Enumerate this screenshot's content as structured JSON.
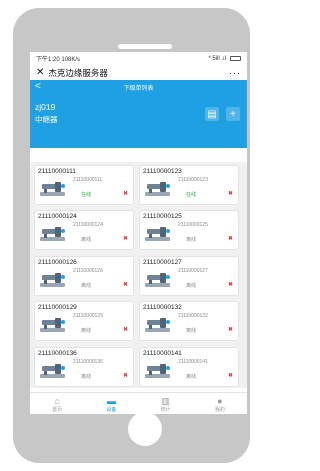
{
  "status_bar": {
    "time": "下午1:20",
    "net": "108K/s",
    "signal": "* 5ill .ıl"
  },
  "mini_header": {
    "close_icon": "close-icon",
    "title": "杰克边缘服务器",
    "more": "···"
  },
  "nav": {
    "back": "<",
    "title": "下级单列表"
  },
  "device": {
    "name": "zj019",
    "type": "中继器"
  },
  "actions": {
    "doc_icon": "▤",
    "add_icon": "+"
  },
  "colors": {
    "brand_blue": "#1fa0e2",
    "online_green": "#2aa745",
    "offline_gray": "#888888",
    "delete_red": "#e53935"
  },
  "cards": [
    {
      "title": "21110000111",
      "sub": "21110000111",
      "status": "在线",
      "status_color": "#2aa745",
      "del": "✖"
    },
    {
      "title": "21110000123",
      "sub": "21110000123",
      "status": "在线",
      "status_color": "#2aa745",
      "del": "✖"
    },
    {
      "title": "21110000124",
      "sub": "21110000124",
      "status": "离线",
      "status_color": "#888888",
      "del": "✖"
    },
    {
      "title": "21110000125",
      "sub": "21110000125",
      "status": "离线",
      "status_color": "#888888",
      "del": "✖"
    },
    {
      "title": "21110000126",
      "sub": "21110000126",
      "status": "离线",
      "status_color": "#888888",
      "del": "✖"
    },
    {
      "title": "21110000127",
      "sub": "21110000127",
      "status": "离线",
      "status_color": "#888888",
      "del": "✖"
    },
    {
      "title": "21110000129",
      "sub": "21110000129",
      "status": "离线",
      "status_color": "#888888",
      "del": "✖"
    },
    {
      "title": "21110000132",
      "sub": "21110000132",
      "status": "离线",
      "status_color": "#888888",
      "del": "✖"
    },
    {
      "title": "21110000136",
      "sub": "21110000136",
      "status": "离线",
      "status_color": "#888888",
      "del": "✖"
    },
    {
      "title": "21110000141",
      "sub": "21110000141",
      "status": "离线",
      "status_color": "#888888",
      "del": "✖"
    }
  ],
  "tabs": [
    {
      "label": "首页",
      "icon": "home-icon",
      "active": false
    },
    {
      "label": "设备",
      "icon": "device-icon",
      "active": true
    },
    {
      "label": "统计",
      "icon": "chart-icon",
      "active": false
    },
    {
      "label": "我的",
      "icon": "user-icon",
      "active": false
    }
  ]
}
